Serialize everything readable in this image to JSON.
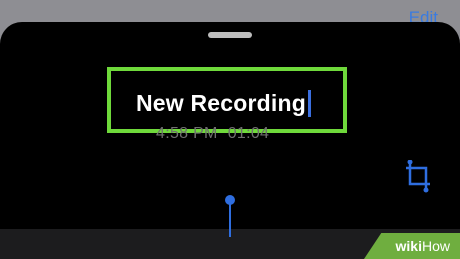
{
  "header": {
    "edit_label": "Edit"
  },
  "recording": {
    "title": "New Recording",
    "time": "4:58 PM",
    "duration": "01:04"
  },
  "icons": {
    "crop": "crop-icon",
    "grabber": "grabber-handle"
  },
  "colors": {
    "highlight": "#6fd93b",
    "accent": "#2f6ee0",
    "sheet_background": "#000000"
  },
  "watermark": {
    "part1": "wiki",
    "part2": "How"
  }
}
